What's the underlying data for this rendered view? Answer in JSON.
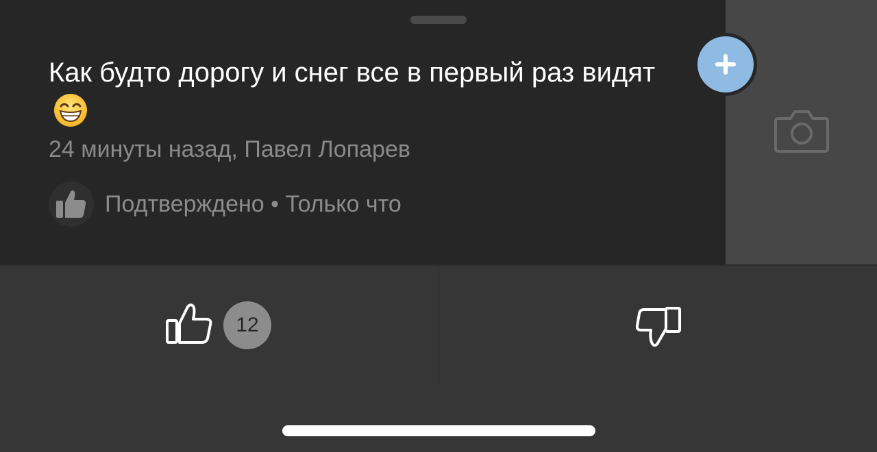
{
  "post": {
    "title": "Как будто дорогу и снег все в первый раз видят",
    "title_emoji": "grinning-face-emoji",
    "meta": "24 минуты назад, Павел Лопарев",
    "confirm_text": "Подтверждено • Только что"
  },
  "actions": {
    "like_count": "12"
  },
  "icons": {
    "confirm": "thumbs-up-filled-icon",
    "add": "plus-icon",
    "camera": "camera-icon",
    "like": "thumbs-up-outline-icon",
    "dislike": "thumbs-down-outline-icon"
  },
  "colors": {
    "card_bg": "#262626",
    "footer_bg": "#363636",
    "side_panel_bg": "#474747",
    "accent_add": "#8fbbe2",
    "text_primary": "#ffffff",
    "text_secondary": "#8a8a8a"
  }
}
